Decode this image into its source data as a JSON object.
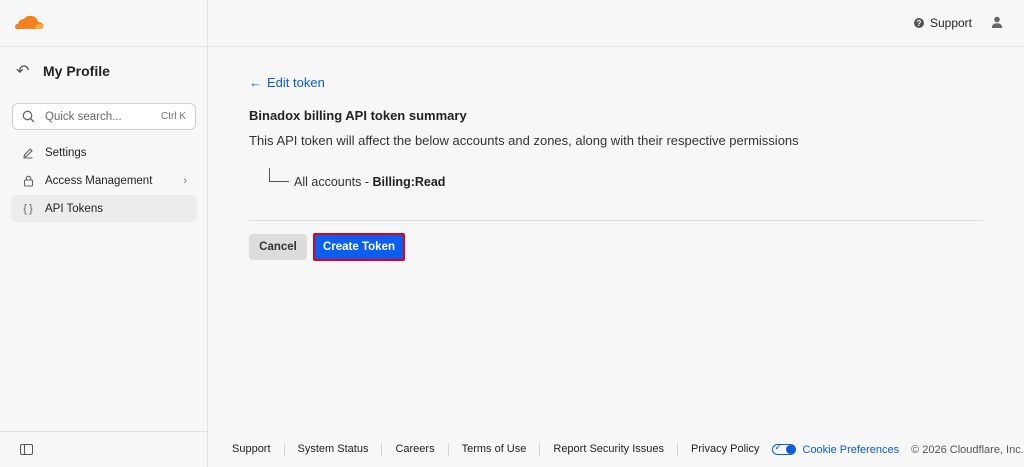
{
  "brand": {
    "logo_icon": "cloudflare-logo-icon",
    "accent": "#f48120"
  },
  "sidebar": {
    "back_icon": "back-arrow-icon",
    "title": "My Profile",
    "search": {
      "placeholder": "Quick search...",
      "shortcut": "Ctrl K"
    },
    "items": [
      {
        "label": "Settings",
        "icon": "pencil-icon"
      },
      {
        "label": "Access Management",
        "icon": "lock-icon",
        "has_children": true
      },
      {
        "label": "API Tokens",
        "icon": "braces-icon",
        "active": true
      }
    ]
  },
  "header": {
    "support_label": "Support"
  },
  "main": {
    "edit_link": "Edit token",
    "summary_title": "Binadox billing API token summary",
    "summary_desc": "This API token will affect the below accounts and zones, along with their respective permissions",
    "account_scope": "All accounts",
    "account_sep": " - ",
    "account_permission": "Billing:Read",
    "cancel_label": "Cancel",
    "create_label": "Create Token",
    "primary_color": "#0b5ff0"
  },
  "footer": {
    "links": [
      "Support",
      "System Status",
      "Careers",
      "Terms of Use",
      "Report Security Issues",
      "Privacy Policy"
    ],
    "cookie_label": "Cookie Preferences",
    "copyright": "© 2026 Cloudflare, Inc."
  }
}
